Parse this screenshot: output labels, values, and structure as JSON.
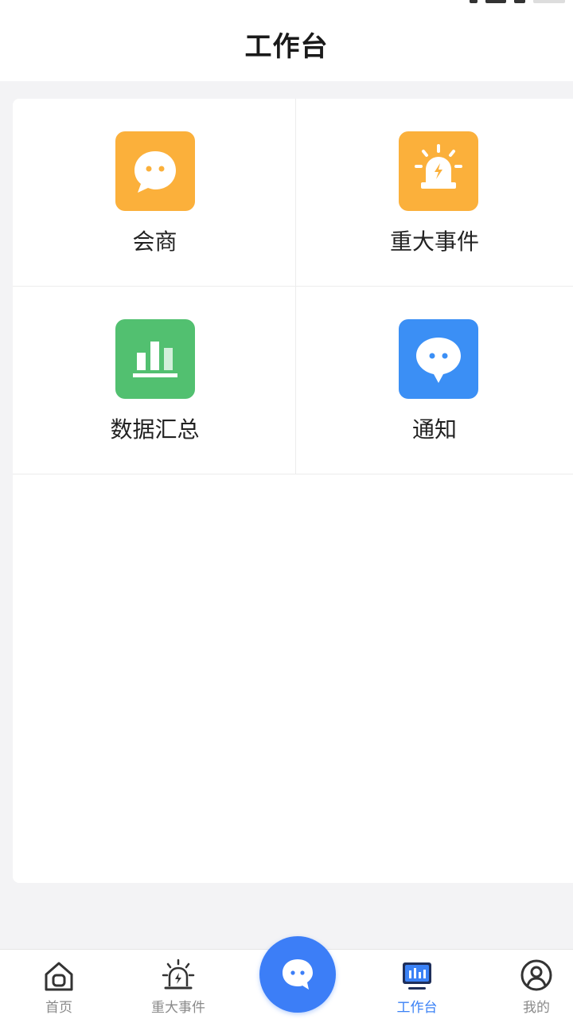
{
  "header": {
    "title": "工作台"
  },
  "grid": [
    {
      "label": "会商",
      "icon": "chat-bubble-icon",
      "color": "#fbb03b"
    },
    {
      "label": "重大事件",
      "icon": "alarm-siren-icon",
      "color": "#fbb03b"
    },
    {
      "label": "数据汇总",
      "icon": "bar-chart-icon",
      "color": "#52c070"
    },
    {
      "label": "通知",
      "icon": "message-icon",
      "color": "#3b8ff5"
    }
  ],
  "tabbar": {
    "items": [
      {
        "label": "首页",
        "icon": "home-icon",
        "active": false
      },
      {
        "label": "重大事件",
        "icon": "alarm-siren-icon",
        "active": false
      },
      {
        "label": "工作台",
        "icon": "workbench-icon",
        "active": true
      },
      {
        "label": "我的",
        "icon": "user-circle-icon",
        "active": false
      }
    ],
    "center_button_icon": "chat-icon",
    "active_color": "#3b82f6",
    "inactive_color": "#8a8a8a"
  }
}
